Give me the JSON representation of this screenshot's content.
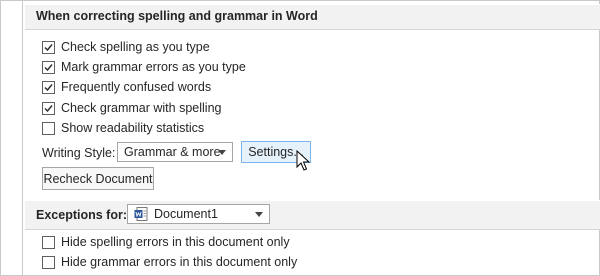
{
  "section1": {
    "title": "When correcting spelling and grammar in Word",
    "options": [
      {
        "label": "Check spelling as you type",
        "checked": true
      },
      {
        "label": "Mark grammar errors as you type",
        "checked": true
      },
      {
        "label": "Frequently confused words",
        "checked": true
      },
      {
        "label": "Check grammar with spelling",
        "checked": true
      },
      {
        "label": "Show readability statistics",
        "checked": false
      }
    ],
    "writing_style_label": "Writing Style:",
    "writing_style_value": "Grammar & more",
    "settings_button": "Settings...",
    "recheck_button": "Recheck Document"
  },
  "section2": {
    "title": "Exceptions for:",
    "document_value": "Document1",
    "options": [
      {
        "label": "Hide spelling errors in this document only",
        "checked": false
      },
      {
        "label": "Hide grammar errors in this document only",
        "checked": false
      }
    ]
  },
  "colors": {
    "header_bg": "#f2f2f2",
    "button_hover_bg": "#e5f1fb",
    "word_blue": "#2b579a"
  }
}
